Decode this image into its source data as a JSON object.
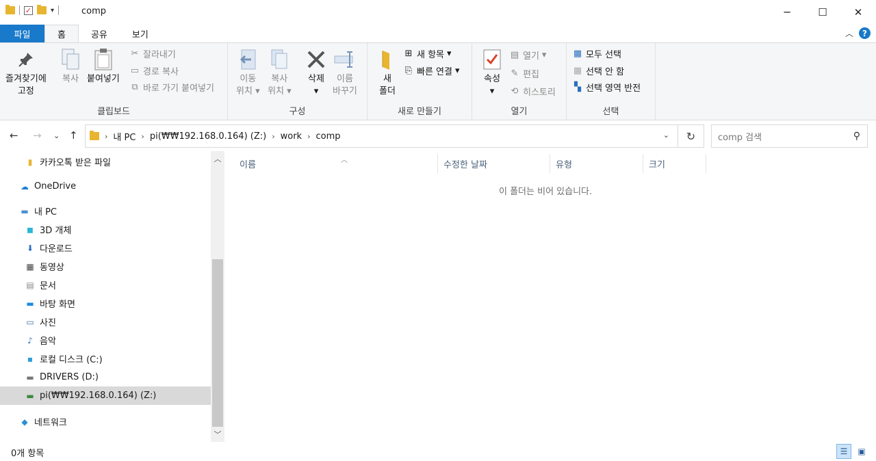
{
  "window": {
    "title": "comp",
    "minimize": "─",
    "maximize": "☐",
    "close": "✕"
  },
  "tabs": [
    "파일",
    "홈",
    "공유",
    "보기"
  ],
  "ribbon": {
    "clipboard": {
      "label": "클립보드",
      "pin_line1": "즐겨찾기에",
      "pin_line2": "고정",
      "copy": "복사",
      "paste": "붙여넣기",
      "cut": "잘라내기",
      "copy_path": "경로 복사",
      "paste_shortcut": "바로 가기 붙여넣기"
    },
    "organize": {
      "label": "구성",
      "move_line1": "이동",
      "move_line2": "위치",
      "copyto_line1": "복사",
      "copyto_line2": "위치",
      "delete_line1": "삭제",
      "rename_line1": "이름",
      "rename_line2": "바꾸기"
    },
    "new": {
      "label": "새로 만들기",
      "new_folder_line1": "새",
      "new_folder_line2": "폴더",
      "new_item": "새 항목",
      "easy_access": "빠른 연결"
    },
    "open": {
      "label": "열기",
      "properties": "속성",
      "open": "열기",
      "edit": "편집",
      "history": "히스토리"
    },
    "select": {
      "label": "선택",
      "select_all": "모두 선택",
      "select_none": "선택 안 함",
      "invert": "선택 영역 반전"
    }
  },
  "address": {
    "crumbs": [
      "내 PC",
      "pi(₩₩192.168.0.164) (Z:)",
      "work",
      "comp"
    ],
    "search_placeholder": "comp 검색"
  },
  "nav": [
    {
      "label": "카카오톡 받은 파일",
      "icon": "folder-icon",
      "indent": 1
    },
    {
      "label": "OneDrive",
      "icon": "cloud-icon",
      "indent": 0
    },
    {
      "label": "내 PC",
      "icon": "computer-icon",
      "indent": 0
    },
    {
      "label": "3D 개체",
      "icon": "cube-icon",
      "indent": 1
    },
    {
      "label": "다운로드",
      "icon": "download-icon",
      "indent": 1
    },
    {
      "label": "동영상",
      "icon": "film-icon",
      "indent": 1
    },
    {
      "label": "문서",
      "icon": "document-icon",
      "indent": 1
    },
    {
      "label": "바탕 화면",
      "icon": "desktop-icon",
      "indent": 1
    },
    {
      "label": "사진",
      "icon": "picture-icon",
      "indent": 1
    },
    {
      "label": "음악",
      "icon": "music-icon",
      "indent": 1
    },
    {
      "label": "로컬 디스크 (C:)",
      "icon": "windows-drive-icon",
      "indent": 1
    },
    {
      "label": "DRIVERS (D:)",
      "icon": "drive-icon",
      "indent": 1
    },
    {
      "label": "pi(₩₩192.168.0.164) (Z:)",
      "icon": "network-drive-icon",
      "indent": 1
    },
    {
      "label": "네트워크",
      "icon": "network-icon",
      "indent": 0
    }
  ],
  "columns": [
    "이름",
    "수정한 날짜",
    "유형",
    "크기"
  ],
  "empty_message": "이 폴더는 비어 있습니다.",
  "status": "0개 항목"
}
